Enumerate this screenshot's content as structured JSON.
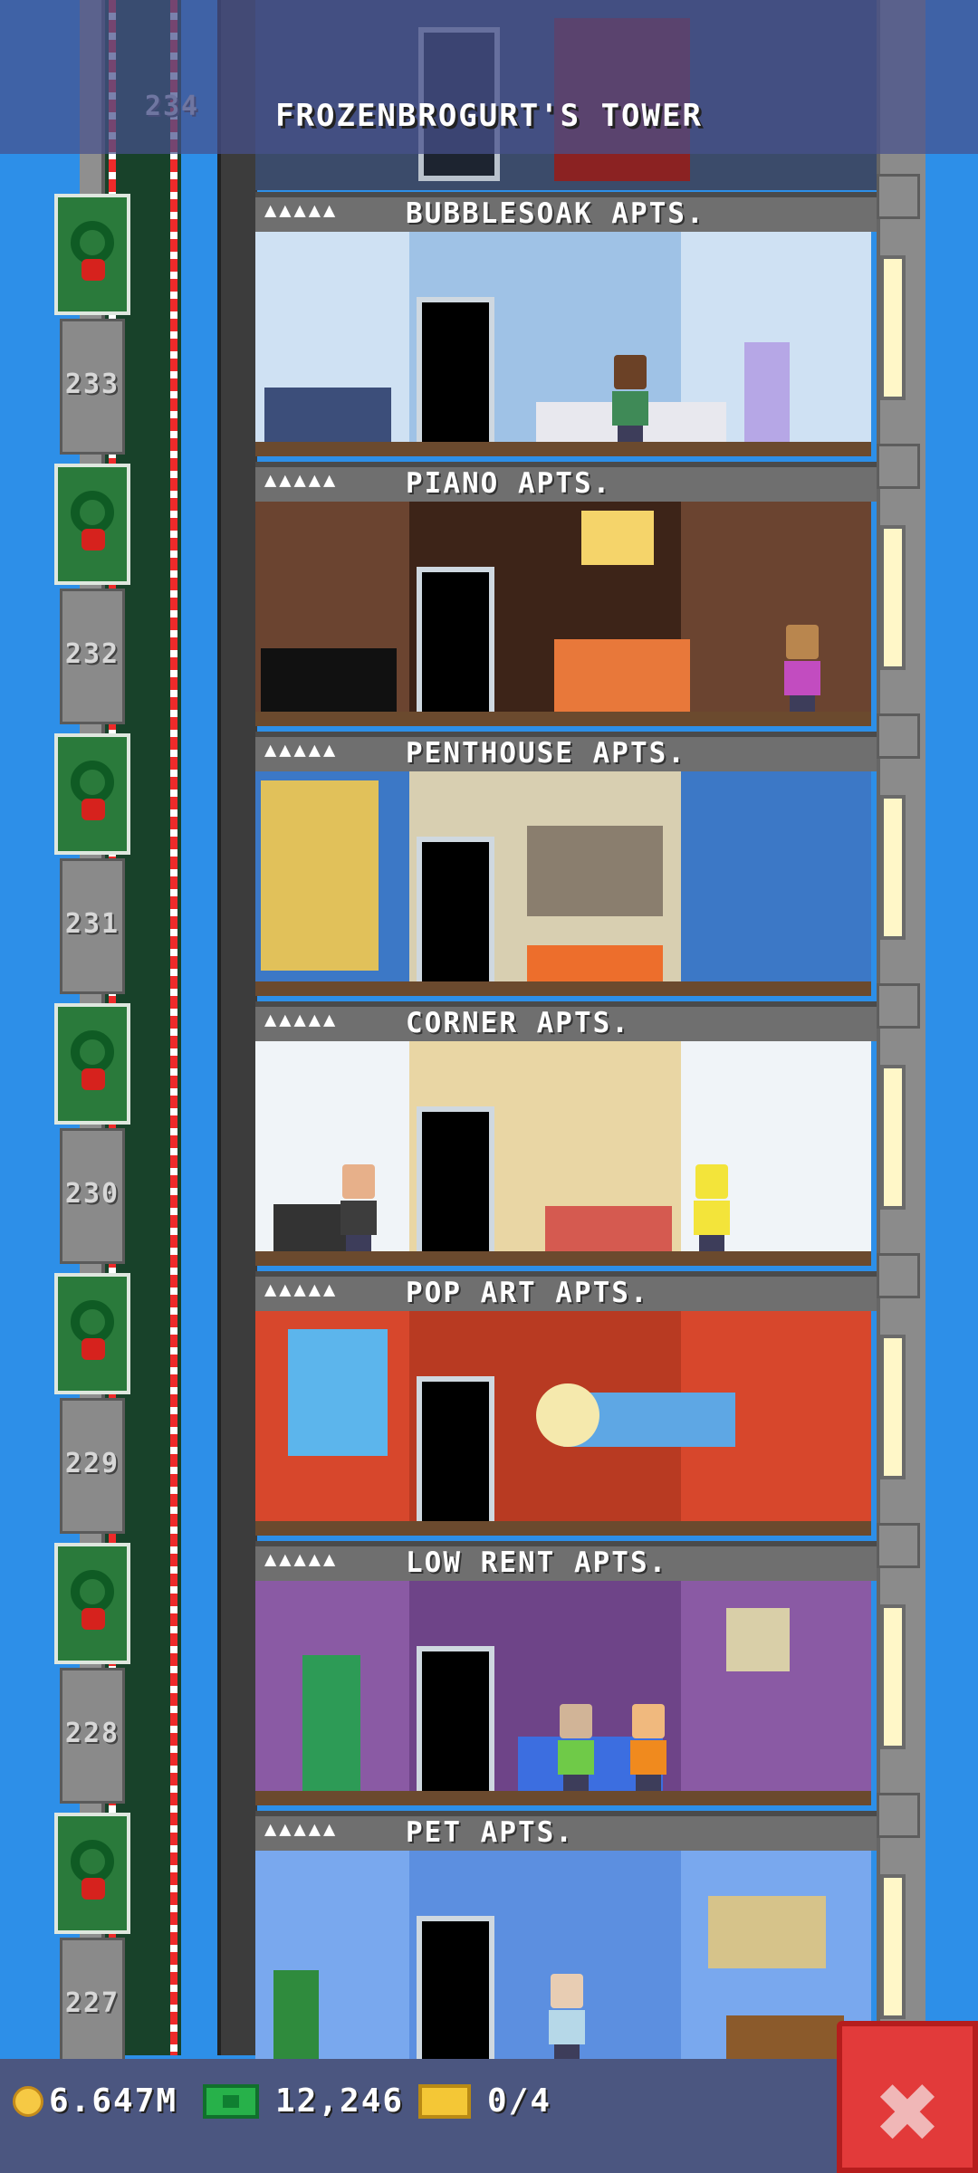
{
  "header": {
    "title": "FROZENBROGURT'S TOWER"
  },
  "floors": [
    {
      "number": "233",
      "stars": "▲▲▲▲▲",
      "name": "BUBBLESOAK APTS.",
      "bg": "#cfe1f3",
      "wall": "#9fc2e6"
    },
    {
      "number": "232",
      "stars": "▲▲▲▲▲",
      "name": "PIANO APTS.",
      "bg": "#6b4430",
      "wall": "#3d2418"
    },
    {
      "number": "231",
      "stars": "▲▲▲▲▲",
      "name": "PENTHOUSE APTS.",
      "bg": "#3c78c6",
      "wall": "#d8cfb1"
    },
    {
      "number": "230",
      "stars": "▲▲▲▲▲",
      "name": "CORNER APTS.",
      "bg": "#f0f4f8",
      "wall": "#e9d6a4"
    },
    {
      "number": "229",
      "stars": "▲▲▲▲▲",
      "name": "POP ART APTS.",
      "bg": "#d7472c",
      "wall": "#b83a22"
    },
    {
      "number": "228",
      "stars": "▲▲▲▲▲",
      "name": "LOW RENT APTS.",
      "bg": "#8a5aa4",
      "wall": "#6e4488"
    },
    {
      "number": "227",
      "stars": "▲▲▲▲▲",
      "name": "PET APTS.",
      "bg": "#79a8ee",
      "wall": "#5c8fe0"
    }
  ],
  "top_floor_number": "234",
  "stats": {
    "coins": "6.647M",
    "bux": "12,246",
    "tickets": "0/4"
  },
  "close_symbol": "✖"
}
